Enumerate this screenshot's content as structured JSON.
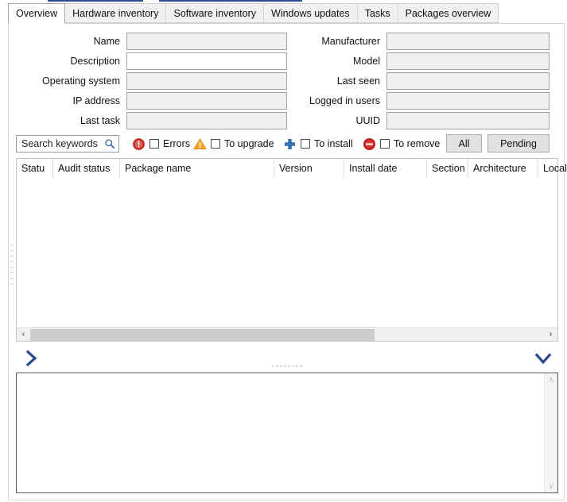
{
  "window": {
    "tabs": [
      {
        "label": "Overview",
        "active": true
      },
      {
        "label": "Hardware inventory",
        "active": false
      },
      {
        "label": "Software inventory",
        "active": false
      },
      {
        "label": "Windows updates",
        "active": false
      },
      {
        "label": "Tasks",
        "active": false
      },
      {
        "label": "Packages overview",
        "active": false
      }
    ]
  },
  "form": {
    "left": [
      {
        "label": "Name",
        "value": "",
        "editable": false
      },
      {
        "label": "Description",
        "value": "",
        "editable": true
      },
      {
        "label": "Operating system",
        "value": "",
        "editable": false
      },
      {
        "label": "IP address",
        "value": "",
        "editable": false
      },
      {
        "label": "Last task",
        "value": "",
        "editable": false
      }
    ],
    "right": [
      {
        "label": "Manufacturer",
        "value": "",
        "editable": false
      },
      {
        "label": "Model",
        "value": "",
        "editable": false
      },
      {
        "label": "Last seen",
        "value": "",
        "editable": false
      },
      {
        "label": "Logged in users",
        "value": "",
        "editable": false
      },
      {
        "label": "UUID",
        "value": "",
        "editable": false
      }
    ]
  },
  "toolbar": {
    "search": {
      "value": "",
      "placeholder": "Search keywords",
      "icon": "search-icon"
    },
    "filters": [
      {
        "label": "Errors",
        "icon": "error-circle-icon",
        "checked": false,
        "color": "#d83a34"
      },
      {
        "label": "To upgrade",
        "icon": "warning-triangle-icon",
        "checked": false,
        "color": "#f0a020"
      },
      {
        "label": "To install",
        "icon": "plus-icon",
        "checked": false,
        "color": "#2f6fb5"
      },
      {
        "label": "To remove",
        "icon": "remove-circle-icon",
        "checked": false,
        "color": "#cf2b28"
      }
    ],
    "buttons": [
      {
        "label": "All"
      },
      {
        "label": "Pending"
      }
    ]
  },
  "table": {
    "columns": [
      {
        "label": "Statu"
      },
      {
        "label": "Audit status"
      },
      {
        "label": "Package name"
      },
      {
        "label": "Version"
      },
      {
        "label": "Install date"
      },
      {
        "label": "Section"
      },
      {
        "label": "Architecture"
      },
      {
        "label": "Locale"
      }
    ],
    "rows": [],
    "hscroll": {
      "left_arrow": "‹",
      "right_arrow": "›"
    }
  },
  "splitter": {
    "expand_left_icon": "chevron-right-icon",
    "expand_down_icon": "chevron-down-icon",
    "accent": "#2b4a8b"
  },
  "details": {
    "text": "",
    "scroll_up": "∧",
    "scroll_down": "∨"
  }
}
